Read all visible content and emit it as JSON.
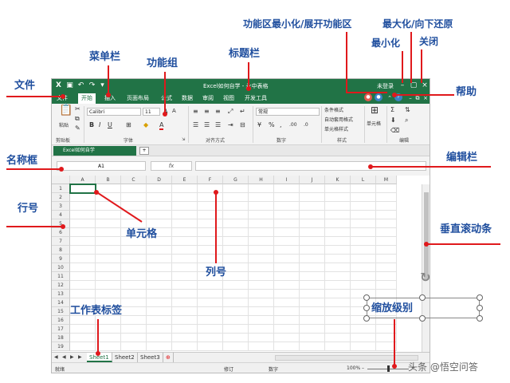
{
  "window": {
    "title": "Excel如何自学 - 永中表格",
    "user": "未登录",
    "colors": {
      "titlebar": "#217346",
      "annotation_text": "#1f4e9e",
      "annotation_line": "#e0191c"
    }
  },
  "menu": {
    "file": "文件",
    "items": [
      "开始",
      "插入",
      "页面布局",
      "公式",
      "数据",
      "审阅",
      "视图",
      "开发工具"
    ]
  },
  "ribbon": {
    "clipboard": {
      "paste": "粘贴",
      "label": "剪贴板"
    },
    "font": {
      "name": "Calibri",
      "size": "11",
      "label": "字体"
    },
    "alignment": {
      "label": "对齐方式"
    },
    "number": {
      "format": "常规",
      "label": "数字"
    },
    "styles": {
      "conditional": "条件格式",
      "table": "自动套用格式",
      "cell": "单元格样式",
      "label": "样式"
    },
    "cells": {
      "button": "单元格"
    },
    "editing": {
      "label": "编辑"
    }
  },
  "doc_tab": {
    "name": "Excel如何自学"
  },
  "formula_bar": {
    "name_box": "A1",
    "fx": "fx"
  },
  "grid": {
    "columns": [
      "A",
      "B",
      "C",
      "D",
      "E",
      "F",
      "G",
      "H",
      "I",
      "J",
      "K",
      "L",
      "M"
    ],
    "rows": [
      "1",
      "2",
      "3",
      "4",
      "5",
      "6",
      "7",
      "8",
      "9",
      "10",
      "11",
      "12",
      "13",
      "14",
      "15",
      "16",
      "17",
      "18",
      "19"
    ]
  },
  "sheets": [
    "Sheet1",
    "Sheet2",
    "Sheet3"
  ],
  "status": {
    "ready": "就绪",
    "revise": "修订",
    "digital": "数字",
    "zoom": "100%"
  },
  "annotations": {
    "file": "文件",
    "menubar": "菜单栏",
    "function_group": "功能组",
    "titlebar": "标题栏",
    "ribbon_toggle": "功能区最小化/展开功能区",
    "maximize": "最大化/向下还原",
    "minimize": "最小化",
    "close": "关闭",
    "help": "帮助",
    "name_box": "名称框",
    "formula_bar": "编辑栏",
    "row_number": "行号",
    "cell": "单元格",
    "vscroll": "垂直滚动条",
    "column_number": "列号",
    "sheet_tab": "工作表标签",
    "zoom": "缩放级别"
  },
  "watermark": "头条 @悟空问答"
}
